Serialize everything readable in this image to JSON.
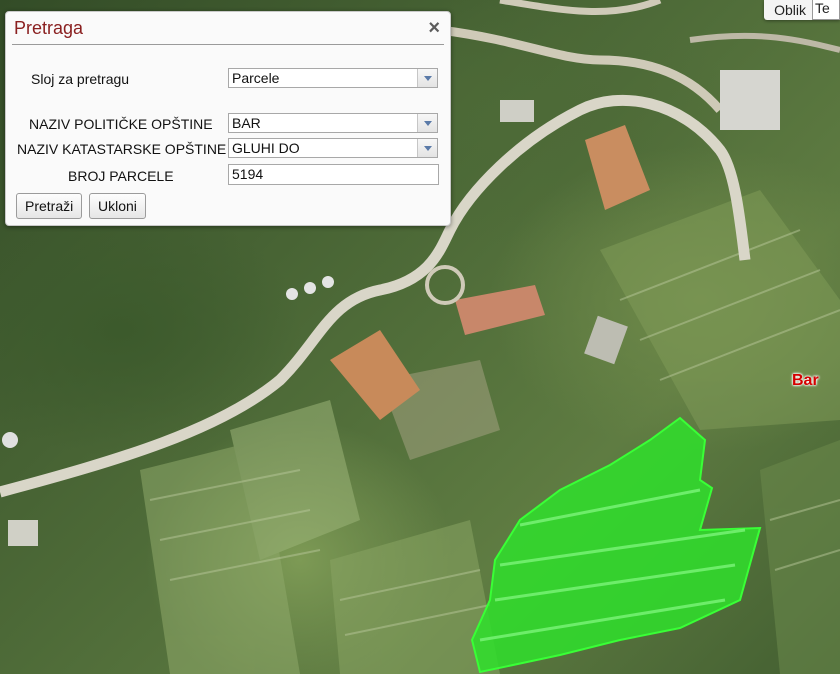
{
  "dialog": {
    "title": "Pretraga",
    "close_symbol": "×",
    "layer_label": "Sloj za pretragu",
    "layer_value": "Parcele",
    "political_label": "NAZIV POLITIČKE OPŠTINE",
    "political_value": "BAR",
    "cadastral_label": "NAZIV KATASTARSKE OPŠTINE",
    "cadastral_value": "GLUHI DO",
    "parcel_label": "BROJ PARCELE",
    "parcel_value": "5194",
    "search_button": "Pretraži",
    "remove_button": "Ukloni"
  },
  "top_control": {
    "label": "Oblik",
    "value": "Te"
  },
  "map": {
    "place_label": "Bar",
    "highlight_color": "#2fe02b"
  },
  "colors": {
    "title": "#8a2020",
    "place_label": "#d40000"
  }
}
